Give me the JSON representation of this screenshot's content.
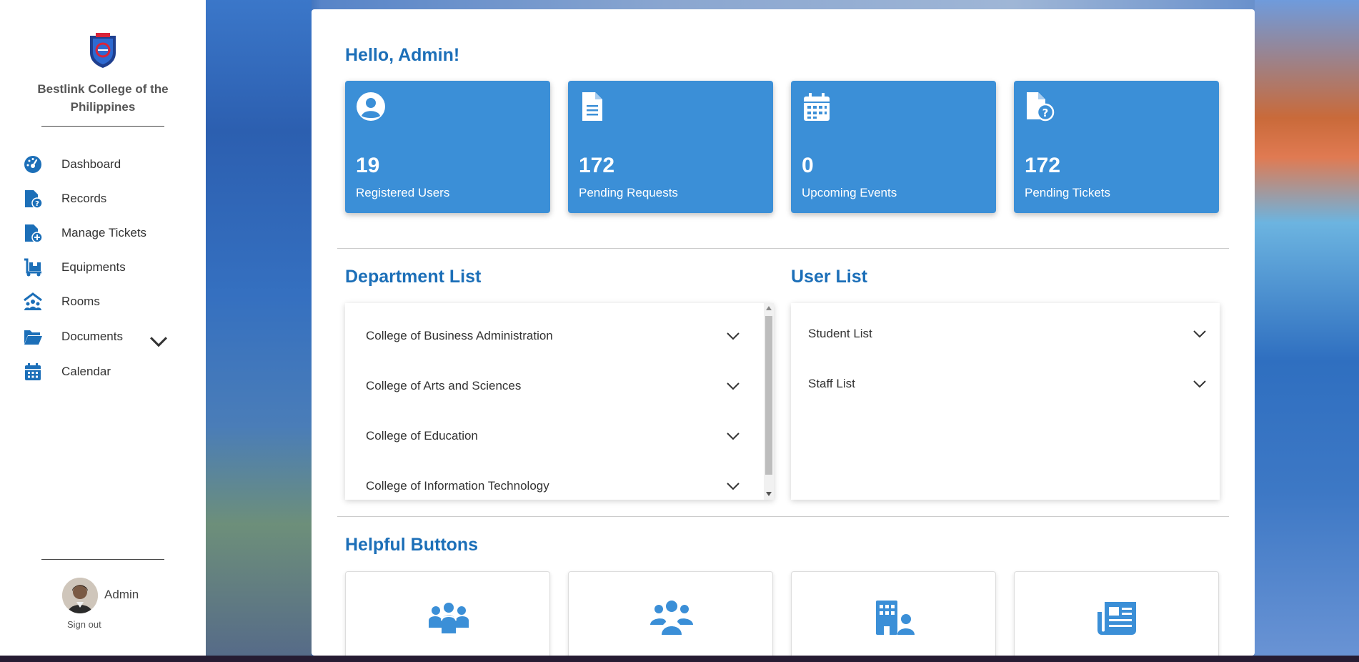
{
  "app": {
    "school_name": "Bestlink College of the Philippines",
    "accent_color": "#1c6fb8",
    "card_color": "#3b8fd7"
  },
  "sidebar": {
    "items": [
      {
        "label": "Dashboard",
        "icon": "gauge-icon"
      },
      {
        "label": "Records",
        "icon": "file-question-icon"
      },
      {
        "label": "Manage Tickets",
        "icon": "file-plus-icon"
      },
      {
        "label": "Equipments",
        "icon": "dolly-icon"
      },
      {
        "label": "Rooms",
        "icon": "people-roof-icon"
      },
      {
        "label": "Documents",
        "icon": "folder-open-icon"
      },
      {
        "label": "Calendar",
        "icon": "calendar-icon"
      }
    ],
    "user": {
      "name": "Admin",
      "signout": "Sign out"
    }
  },
  "main": {
    "greeting": "Hello, Admin!",
    "stats": [
      {
        "value": "19",
        "label": "Registered Users",
        "icon": "user-circle-icon"
      },
      {
        "value": "172",
        "label": "Pending Requests",
        "icon": "file-lines-icon"
      },
      {
        "value": "0",
        "label": "Upcoming Events",
        "icon": "calendar-days-icon"
      },
      {
        "value": "172",
        "label": "Pending Tickets",
        "icon": "file-question-icon"
      }
    ],
    "department_list": {
      "title": "Department List",
      "items": [
        "College of Business Administration",
        "College of Arts and Sciences",
        "College of Education",
        "College of Information Technology"
      ]
    },
    "user_list": {
      "title": "User List",
      "items": [
        "Student List",
        "Staff List"
      ]
    },
    "helpful_buttons": {
      "title": "Helpful Buttons",
      "icons": [
        "people-group-icon",
        "users-icon",
        "building-user-icon",
        "newspaper-icon"
      ]
    }
  }
}
